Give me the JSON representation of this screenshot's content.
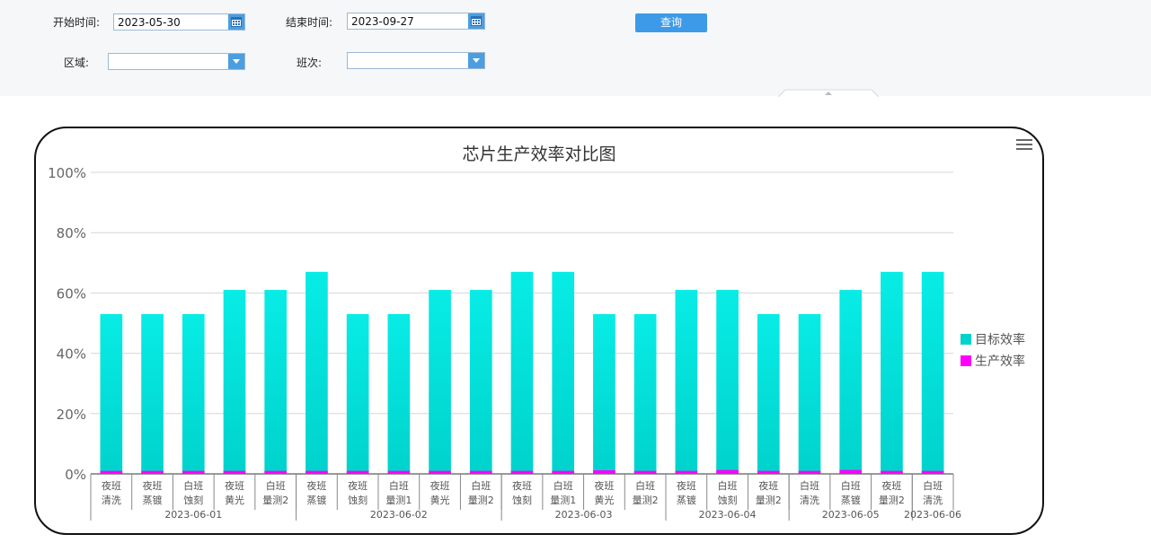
{
  "filters": {
    "start_label": "开始时间:",
    "start_value": "2023-05-30",
    "end_label": "结束时间:",
    "end_value": "2023-09-27",
    "query_label": "查询",
    "area_label": "区域:",
    "area_value": "",
    "shift_label": "班次:",
    "shift_value": ""
  },
  "colors": {
    "target": "#00d2cc",
    "production": "#ff00ff",
    "grid": "#d6d6d6"
  },
  "chart_data": {
    "type": "bar",
    "title": "芯片生产效率对比图",
    "ylim": [
      0,
      100
    ],
    "ytick_labels": [
      "0%",
      "20%",
      "40%",
      "60%",
      "80%",
      "100%"
    ],
    "legend_position": "right",
    "categories": [
      {
        "shift": "夜班",
        "process": "清洗"
      },
      {
        "shift": "夜班",
        "process": "蒸镀"
      },
      {
        "shift": "白班",
        "process": "蚀刻"
      },
      {
        "shift": "夜班",
        "process": "黄光"
      },
      {
        "shift": "白班",
        "process": "量测2"
      },
      {
        "shift": "夜班",
        "process": "蒸镀"
      },
      {
        "shift": "夜班",
        "process": "蚀刻"
      },
      {
        "shift": "白班",
        "process": "量测1"
      },
      {
        "shift": "夜班",
        "process": "黄光"
      },
      {
        "shift": "白班",
        "process": "量测2"
      },
      {
        "shift": "夜班",
        "process": "蚀刻"
      },
      {
        "shift": "白班",
        "process": "量测1"
      },
      {
        "shift": "夜班",
        "process": "黄光"
      },
      {
        "shift": "白班",
        "process": "量测2"
      },
      {
        "shift": "夜班",
        "process": "蒸镀"
      },
      {
        "shift": "白班",
        "process": "蚀刻"
      },
      {
        "shift": "夜班",
        "process": "量测2"
      },
      {
        "shift": "白班",
        "process": "清洗"
      },
      {
        "shift": "白班",
        "process": "蒸镀"
      },
      {
        "shift": "夜班",
        "process": "量测2"
      },
      {
        "shift": "白班",
        "process": "清洗"
      }
    ],
    "dates": [
      {
        "label": "2023-06-01",
        "count": 5
      },
      {
        "label": "2023-06-02",
        "count": 5
      },
      {
        "label": "2023-06-03",
        "count": 4
      },
      {
        "label": "2023-06-04",
        "count": 3
      },
      {
        "label": "2023-06-05",
        "count": 3
      },
      {
        "label": "2023-06-06",
        "count": 1
      }
    ],
    "series": [
      {
        "name": "目标效率",
        "values": [
          53,
          53,
          53,
          61,
          61,
          67,
          53,
          53,
          61,
          61,
          67,
          67,
          53,
          53,
          61,
          61,
          53,
          53,
          61,
          67,
          67
        ]
      },
      {
        "name": "生产效率",
        "values": [
          1,
          1,
          1,
          1,
          1,
          1,
          1,
          1,
          1,
          1,
          1,
          1,
          1.2,
          1,
          1,
          1.3,
          1,
          1,
          1.3,
          1,
          1
        ]
      }
    ]
  }
}
